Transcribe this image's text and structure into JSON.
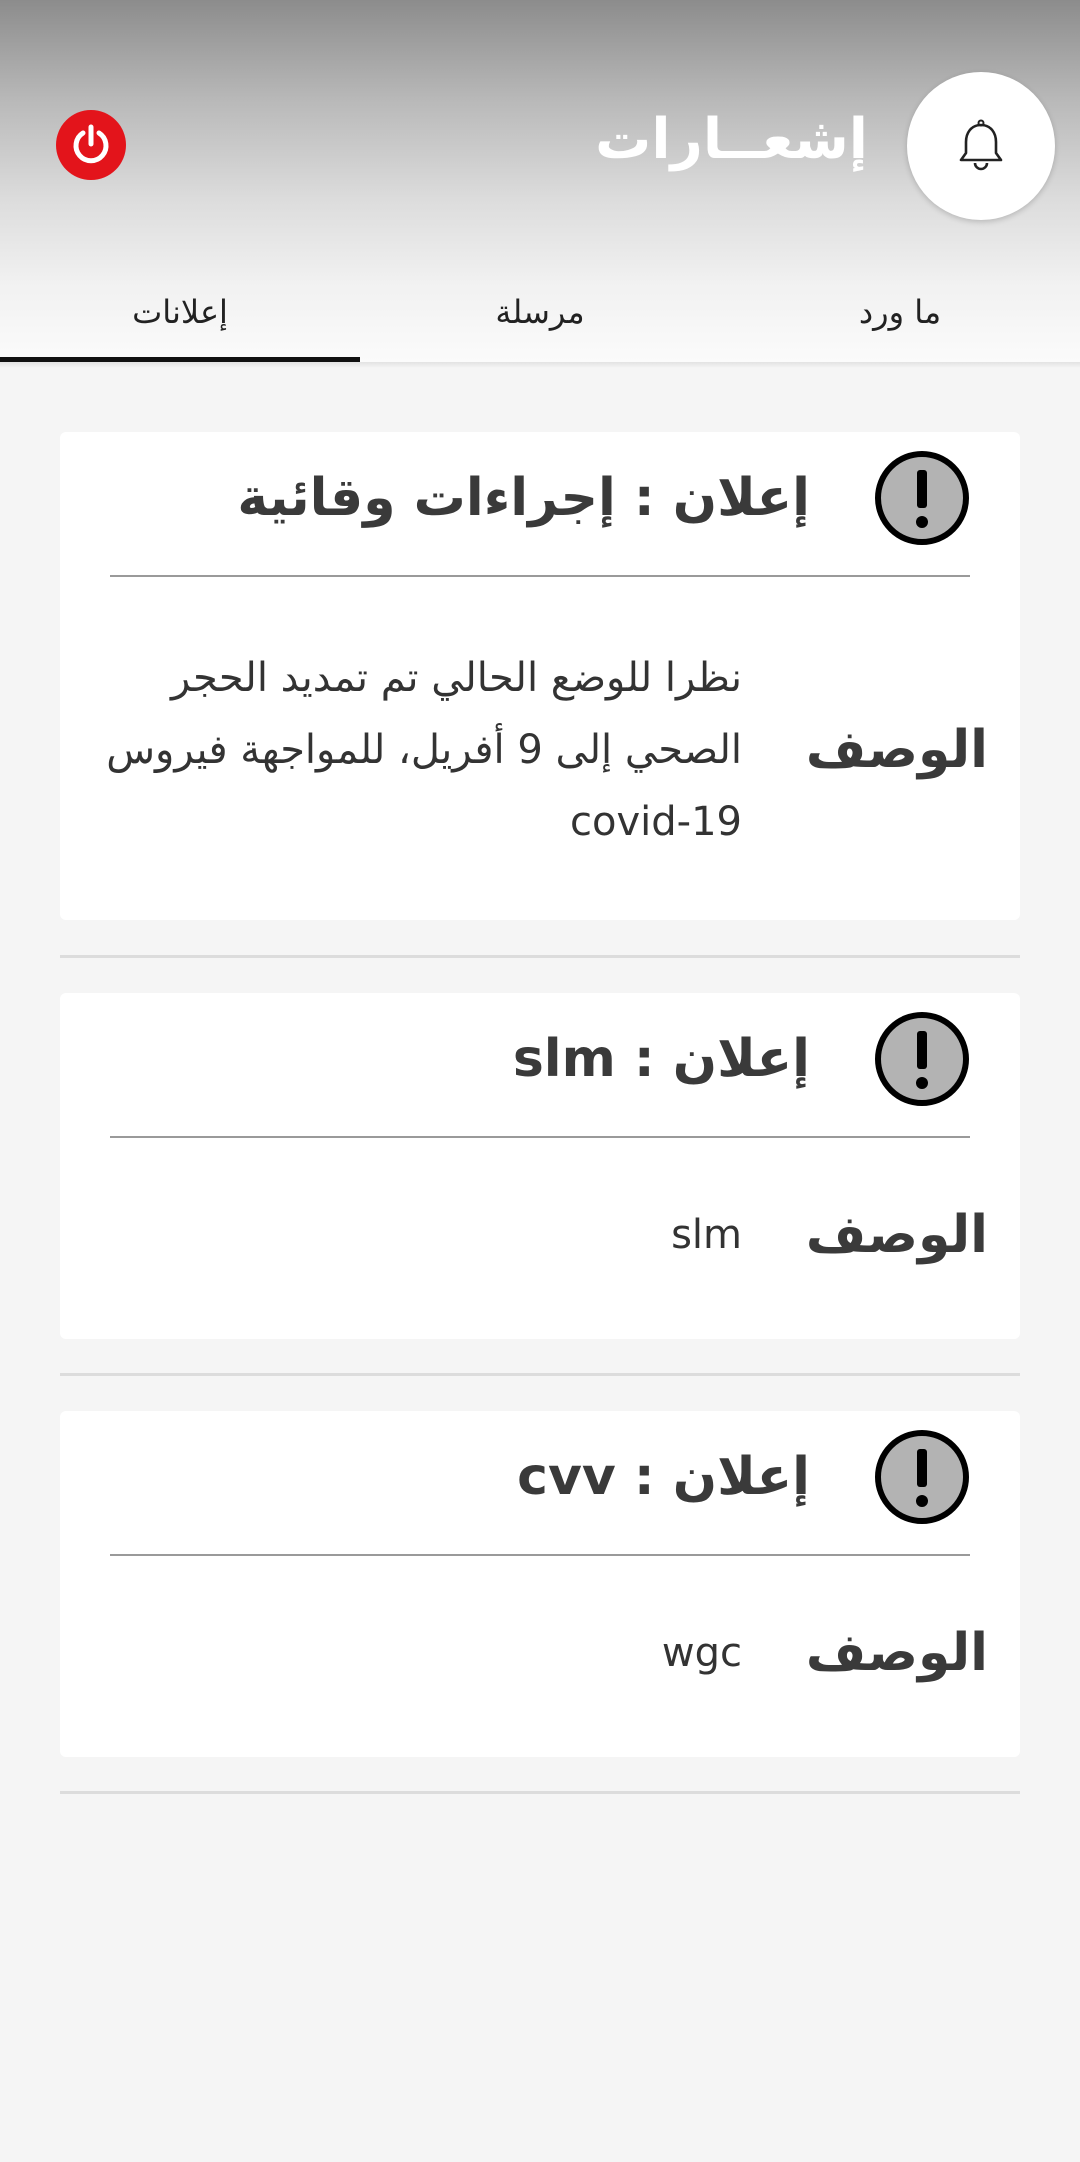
{
  "header": {
    "title": "إشعــارات",
    "bell_icon": "bell-icon",
    "power_icon": "power-icon",
    "power_color": "#e3141b"
  },
  "tabs": [
    {
      "label": "ما ورد",
      "active": false
    },
    {
      "label": "مرسلة",
      "active": false
    },
    {
      "label": "إعلانات",
      "active": true
    }
  ],
  "cards": [
    {
      "icon": "alert-icon",
      "title": "إعلان : إجراءات وقائية",
      "desc_label": "الوصف",
      "desc": "نظرا للوضع الحالي تم تمديد الحجر الصحي إلى 9 أفريل، للمواجهة فيروس covid-19"
    },
    {
      "icon": "alert-icon",
      "title": "إعلان : slm",
      "desc_label": "الوصف",
      "desc": "slm"
    },
    {
      "icon": "alert-icon",
      "title": "إعلان : cvv",
      "desc_label": "الوصف",
      "desc": "wgc"
    }
  ]
}
